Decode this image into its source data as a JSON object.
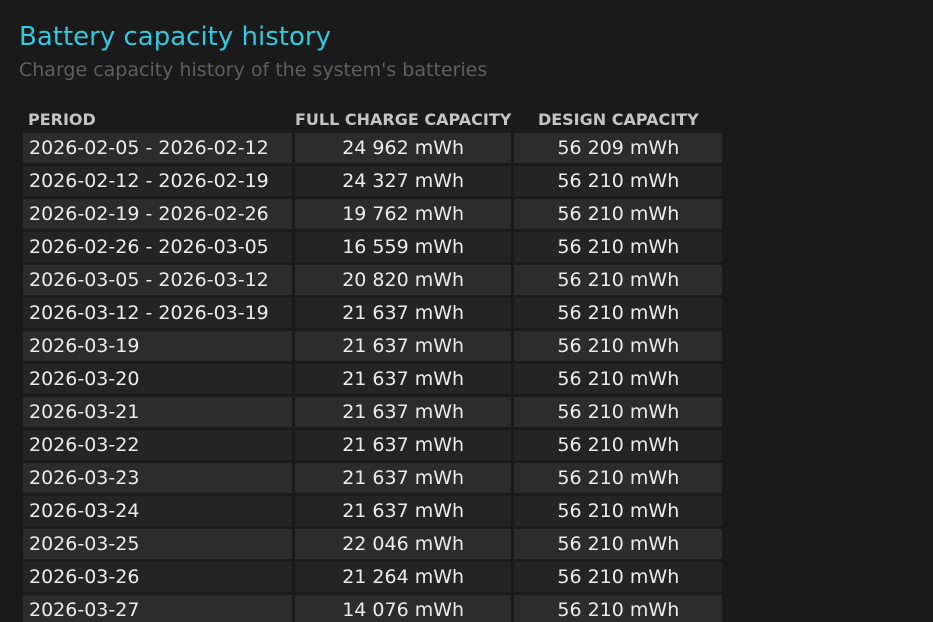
{
  "header": {
    "title": "Battery capacity history",
    "subtitle": "Charge capacity history of the system's batteries"
  },
  "table": {
    "columns": [
      "PERIOD",
      "FULL CHARGE CAPACITY",
      "DESIGN CAPACITY"
    ],
    "rows": [
      {
        "period": "2026-02-05 - 2026-02-12",
        "full": "24 962 mWh",
        "design": "56 209 mWh"
      },
      {
        "period": "2026-02-12 - 2026-02-19",
        "full": "24 327 mWh",
        "design": "56 210 mWh"
      },
      {
        "period": "2026-02-19 - 2026-02-26",
        "full": "19 762 mWh",
        "design": "56 210 mWh"
      },
      {
        "period": "2026-02-26 - 2026-03-05",
        "full": "16 559 mWh",
        "design": "56 210 mWh"
      },
      {
        "period": "2026-03-05 - 2026-03-12",
        "full": "20 820 mWh",
        "design": "56 210 mWh"
      },
      {
        "period": "2026-03-12 - 2026-03-19",
        "full": "21 637 mWh",
        "design": "56 210 mWh"
      },
      {
        "period": "2026-03-19",
        "full": "21 637 mWh",
        "design": "56 210 mWh"
      },
      {
        "period": "2026-03-20",
        "full": "21 637 mWh",
        "design": "56 210 mWh"
      },
      {
        "period": "2026-03-21",
        "full": "21 637 mWh",
        "design": "56 210 mWh"
      },
      {
        "period": "2026-03-22",
        "full": "21 637 mWh",
        "design": "56 210 mWh"
      },
      {
        "period": "2026-03-23",
        "full": "21 637 mWh",
        "design": "56 210 mWh"
      },
      {
        "period": "2026-03-24",
        "full": "21 637 mWh",
        "design": "56 210 mWh"
      },
      {
        "period": "2026-03-25",
        "full": "22 046 mWh",
        "design": "56 210 mWh"
      },
      {
        "period": "2026-03-26",
        "full": "21 264 mWh",
        "design": "56 210 mWh"
      },
      {
        "period": "2026-03-27",
        "full": "14 076 mWh",
        "design": "56 210 mWh"
      }
    ]
  },
  "colors": {
    "background": "#1a1a1a",
    "title": "#35c6e0",
    "subtitle": "#5f5f5f",
    "header_text": "#c4c4c4",
    "cell_text": "#ececec",
    "row_odd": "#2c2c2c",
    "row_even": "#242424"
  }
}
